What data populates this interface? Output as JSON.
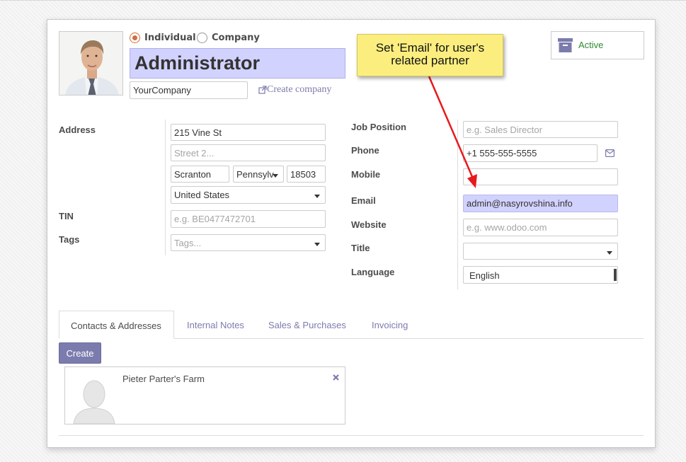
{
  "header": {
    "partner_type_options": [
      {
        "label": "Individual",
        "selected": true
      },
      {
        "label": "Company",
        "selected": false
      }
    ],
    "name": "Administrator",
    "company_value": "YourCompany",
    "create_company_link": "Create company",
    "active_label": "Active"
  },
  "tooltip": {
    "line1": "Set 'Email' for user's",
    "line2": "related partner"
  },
  "address": {
    "label": "Address",
    "street": "215 Vine St",
    "street2_placeholder": "Street 2...",
    "city": "Scranton",
    "state": "Pennsylv",
    "zip": "18503",
    "country": "United States"
  },
  "tin": {
    "label": "TIN",
    "placeholder": "e.g. BE0477472701"
  },
  "tags": {
    "label": "Tags",
    "placeholder": "Tags..."
  },
  "contact": {
    "job_position": {
      "label": "Job Position",
      "placeholder": "e.g. Sales Director"
    },
    "phone": {
      "label": "Phone",
      "value": "+1 555-555-5555"
    },
    "mobile": {
      "label": "Mobile",
      "value": ""
    },
    "email": {
      "label": "Email",
      "value": "admin@nasyrovshina.info"
    },
    "website": {
      "label": "Website",
      "placeholder": "e.g. www.odoo.com"
    },
    "title": {
      "label": "Title",
      "value": ""
    },
    "language": {
      "label": "Language",
      "value": "English"
    }
  },
  "tabs": [
    {
      "label": "Contacts & Addresses",
      "active": true
    },
    {
      "label": "Internal Notes",
      "active": false
    },
    {
      "label": "Sales & Purchases",
      "active": false
    },
    {
      "label": "Invoicing",
      "active": false
    }
  ],
  "contacts": {
    "create_label": "Create",
    "cards": [
      {
        "name": "Pieter Parter's Farm"
      }
    ]
  },
  "colors": {
    "accent": "#7c7bad",
    "radio_selected": "#d06e3d",
    "highlight_field": "#d2d2ff",
    "tooltip_bg": "#fbee7f",
    "arrow": "#e8191b",
    "active_text": "#2e8b2e"
  },
  "icons": {
    "external_link": "external-link-icon",
    "send_mail": "envelope-icon",
    "archive": "archive-box-icon",
    "remove": "close-icon"
  }
}
